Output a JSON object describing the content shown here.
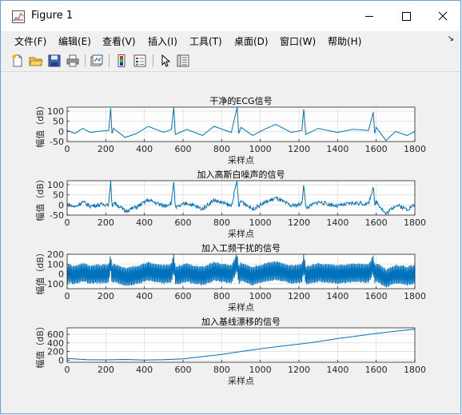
{
  "window": {
    "title": "Figure 1",
    "icon": "matlab-figure-icon",
    "controls": [
      "minimize-icon",
      "maximize-icon",
      "close-icon"
    ]
  },
  "menu": [
    {
      "label": "文件(F)"
    },
    {
      "label": "编辑(E)"
    },
    {
      "label": "查看(V)"
    },
    {
      "label": "插入(I)"
    },
    {
      "label": "工具(T)"
    },
    {
      "label": "桌面(D)"
    },
    {
      "label": "窗口(W)"
    },
    {
      "label": "帮助(H)"
    }
  ],
  "toolbar": [
    "new-figure-icon",
    "open-file-icon",
    "save-icon",
    "print-icon",
    "link-plot-icon",
    "insert-colorbar-icon",
    "insert-legend-icon",
    "edit-plot-pointer-icon",
    "property-inspector-icon"
  ],
  "colors": {
    "line": "#0072bd",
    "grid": "#dedede",
    "axes_bg": "#ffffff"
  },
  "chart_data": [
    {
      "type": "line",
      "title": "干净的ECG信号",
      "xlabel": "采样点",
      "ylabel": "幅值（dB）",
      "xlim": [
        0,
        1800
      ],
      "ylim": [
        -50,
        120
      ],
      "xticks": [
        0,
        200,
        400,
        600,
        800,
        1000,
        1200,
        1400,
        1600,
        1800
      ],
      "yticks": [
        -50,
        0,
        50,
        100
      ],
      "grid": true,
      "series": [
        {
          "x": [
            0,
            40,
            80,
            120,
            160,
            215,
            225,
            232,
            240,
            300,
            360,
            420,
            500,
            540,
            552,
            560,
            620,
            700,
            760,
            850,
            880,
            888,
            900,
            960,
            1020,
            1080,
            1160,
            1215,
            1225,
            1235,
            1300,
            1400,
            1480,
            1560,
            1585,
            1592,
            1600,
            1650,
            1700,
            1760,
            1800
          ],
          "y": [
            5,
            -10,
            15,
            -5,
            0,
            5,
            115,
            -10,
            15,
            -30,
            -10,
            25,
            -5,
            10,
            120,
            -15,
            10,
            -20,
            25,
            -5,
            120,
            -10,
            20,
            -20,
            10,
            35,
            -5,
            5,
            110,
            -15,
            15,
            -5,
            10,
            5,
            95,
            -10,
            20,
            -45,
            0,
            -20,
            0
          ]
        }
      ]
    },
    {
      "type": "line",
      "title": "加入高斯白噪声的信号",
      "xlabel": "采样点",
      "ylabel": "幅值（dB）",
      "xlim": [
        0,
        1800
      ],
      "ylim": [
        -50,
        120
      ],
      "xticks": [
        0,
        200,
        400,
        600,
        800,
        1000,
        1200,
        1400,
        1600,
        1800
      ],
      "yticks": [
        -50,
        0,
        50,
        100
      ],
      "grid": true,
      "series": [
        {
          "x": [
            0,
            40,
            80,
            120,
            160,
            215,
            225,
            232,
            240,
            300,
            360,
            420,
            500,
            540,
            552,
            560,
            620,
            700,
            760,
            850,
            880,
            888,
            900,
            960,
            1020,
            1080,
            1160,
            1215,
            1225,
            1235,
            1300,
            1400,
            1480,
            1560,
            1585,
            1592,
            1600,
            1650,
            1700,
            1760,
            1800
          ],
          "y": [
            5,
            -10,
            15,
            -5,
            0,
            5,
            115,
            -10,
            15,
            -30,
            -10,
            25,
            -5,
            10,
            120,
            -15,
            10,
            -20,
            25,
            -5,
            120,
            -10,
            20,
            -20,
            10,
            35,
            -5,
            5,
            110,
            -15,
            15,
            -5,
            10,
            5,
            95,
            -10,
            20,
            -45,
            0,
            -20,
            0
          ],
          "noise": 10
        }
      ]
    },
    {
      "type": "line",
      "title": "加入工频干扰的信号",
      "xlabel": "采样点",
      "ylabel": "幅值（dB）",
      "xlim": [
        0,
        1800
      ],
      "ylim": [
        -150,
        200
      ],
      "xticks": [
        0,
        200,
        400,
        600,
        800,
        1000,
        1200,
        1400,
        1600,
        1800
      ],
      "yticks": [
        -100,
        0,
        100,
        200
      ],
      "grid": true,
      "series": [
        {
          "x": [
            0,
            40,
            80,
            120,
            160,
            215,
            225,
            232,
            240,
            300,
            360,
            420,
            500,
            540,
            552,
            560,
            620,
            700,
            760,
            850,
            880,
            888,
            900,
            960,
            1020,
            1080,
            1160,
            1215,
            1225,
            1235,
            1300,
            1400,
            1480,
            1560,
            1585,
            1592,
            1600,
            1650,
            1700,
            1760,
            1800
          ],
          "y": [
            5,
            -10,
            15,
            -5,
            0,
            5,
            115,
            -10,
            15,
            -30,
            -10,
            25,
            -5,
            10,
            120,
            -15,
            10,
            -20,
            25,
            -5,
            120,
            -10,
            20,
            -20,
            10,
            35,
            -5,
            5,
            110,
            -15,
            15,
            -5,
            10,
            5,
            95,
            -10,
            20,
            -45,
            0,
            -20,
            0
          ],
          "oscillation_amplitude": 100
        }
      ]
    },
    {
      "type": "line",
      "title": "加入基线漂移的信号",
      "xlabel": "采样点",
      "ylabel": "幅值（dB）",
      "xlim": [
        0,
        1800
      ],
      "ylim": [
        -50,
        750
      ],
      "xticks": [
        0,
        200,
        400,
        600,
        800,
        1000,
        1200,
        1400,
        1600,
        1800
      ],
      "yticks": [
        0,
        200,
        400,
        600
      ],
      "grid": true,
      "series": [
        {
          "x": [
            0,
            100,
            200,
            300,
            400,
            500,
            600,
            700,
            800,
            900,
            1000,
            1100,
            1200,
            1300,
            1400,
            1500,
            1600,
            1700,
            1800
          ],
          "y": [
            40,
            10,
            5,
            15,
            0,
            10,
            30,
            80,
            130,
            200,
            260,
            320,
            370,
            430,
            500,
            560,
            620,
            670,
            720
          ]
        }
      ]
    }
  ]
}
